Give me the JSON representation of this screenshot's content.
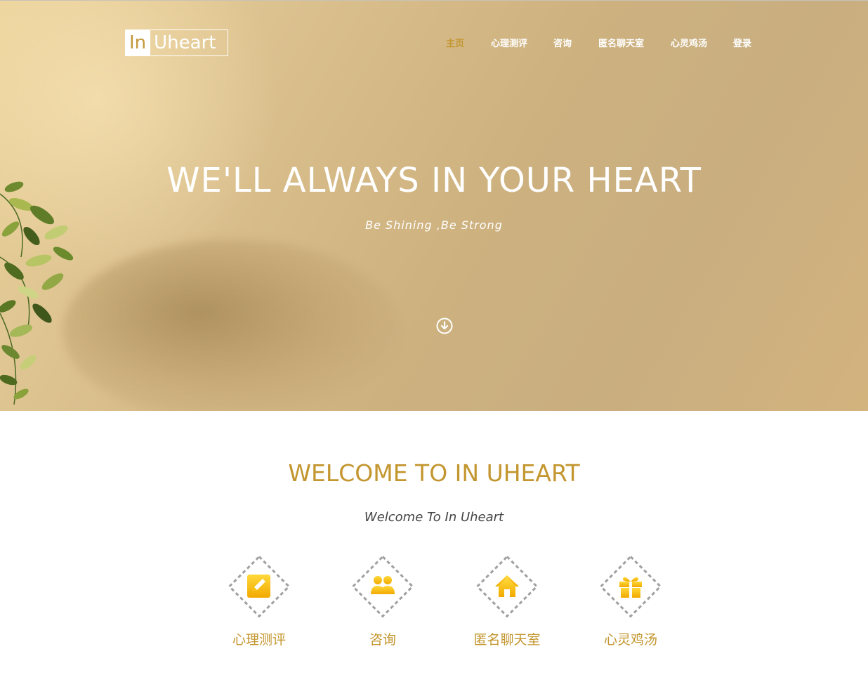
{
  "logo": {
    "part1": "In",
    "part2": "Uheart"
  },
  "nav": {
    "items": [
      {
        "label": "主页",
        "active": true
      },
      {
        "label": "心理测评",
        "active": false
      },
      {
        "label": "咨询",
        "active": false
      },
      {
        "label": "匿名聊天室",
        "active": false
      },
      {
        "label": "心灵鸡汤",
        "active": false
      },
      {
        "label": "登录",
        "active": false
      }
    ]
  },
  "hero": {
    "title": "WE'LL ALWAYS IN YOUR HEART",
    "subtitle": "Be Shining ,Be Strong",
    "scroll_icon": "arrow-down-circle-icon"
  },
  "welcome": {
    "title": "WELCOME TO IN UHEART",
    "subtitle": "Welcome To In Uheart"
  },
  "features": [
    {
      "label": "心理测评",
      "icon": "pencil-edit-icon"
    },
    {
      "label": "咨询",
      "icon": "users-icon"
    },
    {
      "label": "匿名聊天室",
      "icon": "home-icon"
    },
    {
      "label": "心灵鸡汤",
      "icon": "gift-icon"
    }
  ],
  "colors": {
    "accent": "#c3962f",
    "icon_gold": "#f5b800",
    "hero_bg": "#d4b985",
    "diamond_border": "#a0a0a0"
  }
}
